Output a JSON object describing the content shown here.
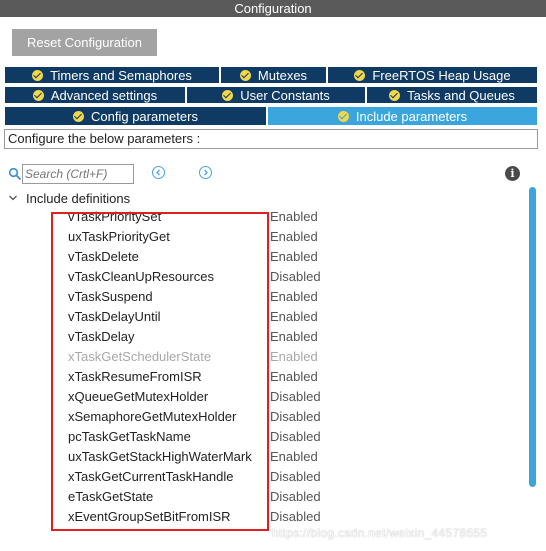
{
  "window": {
    "title": "Configuration"
  },
  "toolbar": {
    "reset_label": "Reset Configuration"
  },
  "tabs": {
    "timers": "Timers and Semaphores",
    "mutexes": "Mutexes",
    "heap": "FreeRTOS Heap Usage",
    "advanced": "Advanced settings",
    "user_constants": "User Constants",
    "tasks_queues": "Tasks and Queues",
    "config_params": "Config parameters",
    "include_params": "Include parameters"
  },
  "hint": "Configure the below parameters :",
  "search": {
    "placeholder": "Search (Crtl+F)"
  },
  "section": {
    "title": "Include definitions"
  },
  "parameters": [
    {
      "name": "vTaskPrioritySet",
      "value": "Enabled",
      "dim": false
    },
    {
      "name": "uxTaskPriorityGet",
      "value": "Enabled",
      "dim": false
    },
    {
      "name": "vTaskDelete",
      "value": "Enabled",
      "dim": false
    },
    {
      "name": "vTaskCleanUpResources",
      "value": "Disabled",
      "dim": false
    },
    {
      "name": "vTaskSuspend",
      "value": "Enabled",
      "dim": false
    },
    {
      "name": "vTaskDelayUntil",
      "value": "Enabled",
      "dim": false
    },
    {
      "name": "vTaskDelay",
      "value": "Enabled",
      "dim": false
    },
    {
      "name": "xTaskGetSchedulerState",
      "value": "Enabled",
      "dim": true
    },
    {
      "name": "xTaskResumeFromISR",
      "value": "Enabled",
      "dim": false
    },
    {
      "name": "xQueueGetMutexHolder",
      "value": "Disabled",
      "dim": false
    },
    {
      "name": "xSemaphoreGetMutexHolder",
      "value": "Disabled",
      "dim": false
    },
    {
      "name": "pcTaskGetTaskName",
      "value": "Disabled",
      "dim": false
    },
    {
      "name": "uxTaskGetStackHighWaterMark",
      "value": "Enabled",
      "dim": false
    },
    {
      "name": "xTaskGetCurrentTaskHandle",
      "value": "Disabled",
      "dim": false
    },
    {
      "name": "eTaskGetState",
      "value": "Disabled",
      "dim": false
    },
    {
      "name": "xEventGroupSetBitFromISR",
      "value": "Disabled",
      "dim": false
    }
  ],
  "watermark": "https://blog.csdn.net/weixin_44578655",
  "colors": {
    "tab_dark": "#0e3a63",
    "tab_active": "#3ba6dd",
    "check": "#f2d64b",
    "highlight_box": "#e02020",
    "title_bar": "#5a5a5a"
  },
  "icons": [
    "check-circle-icon",
    "search-icon",
    "arrow-left-icon",
    "arrow-right-icon",
    "info-icon",
    "chevron-down-icon"
  ]
}
